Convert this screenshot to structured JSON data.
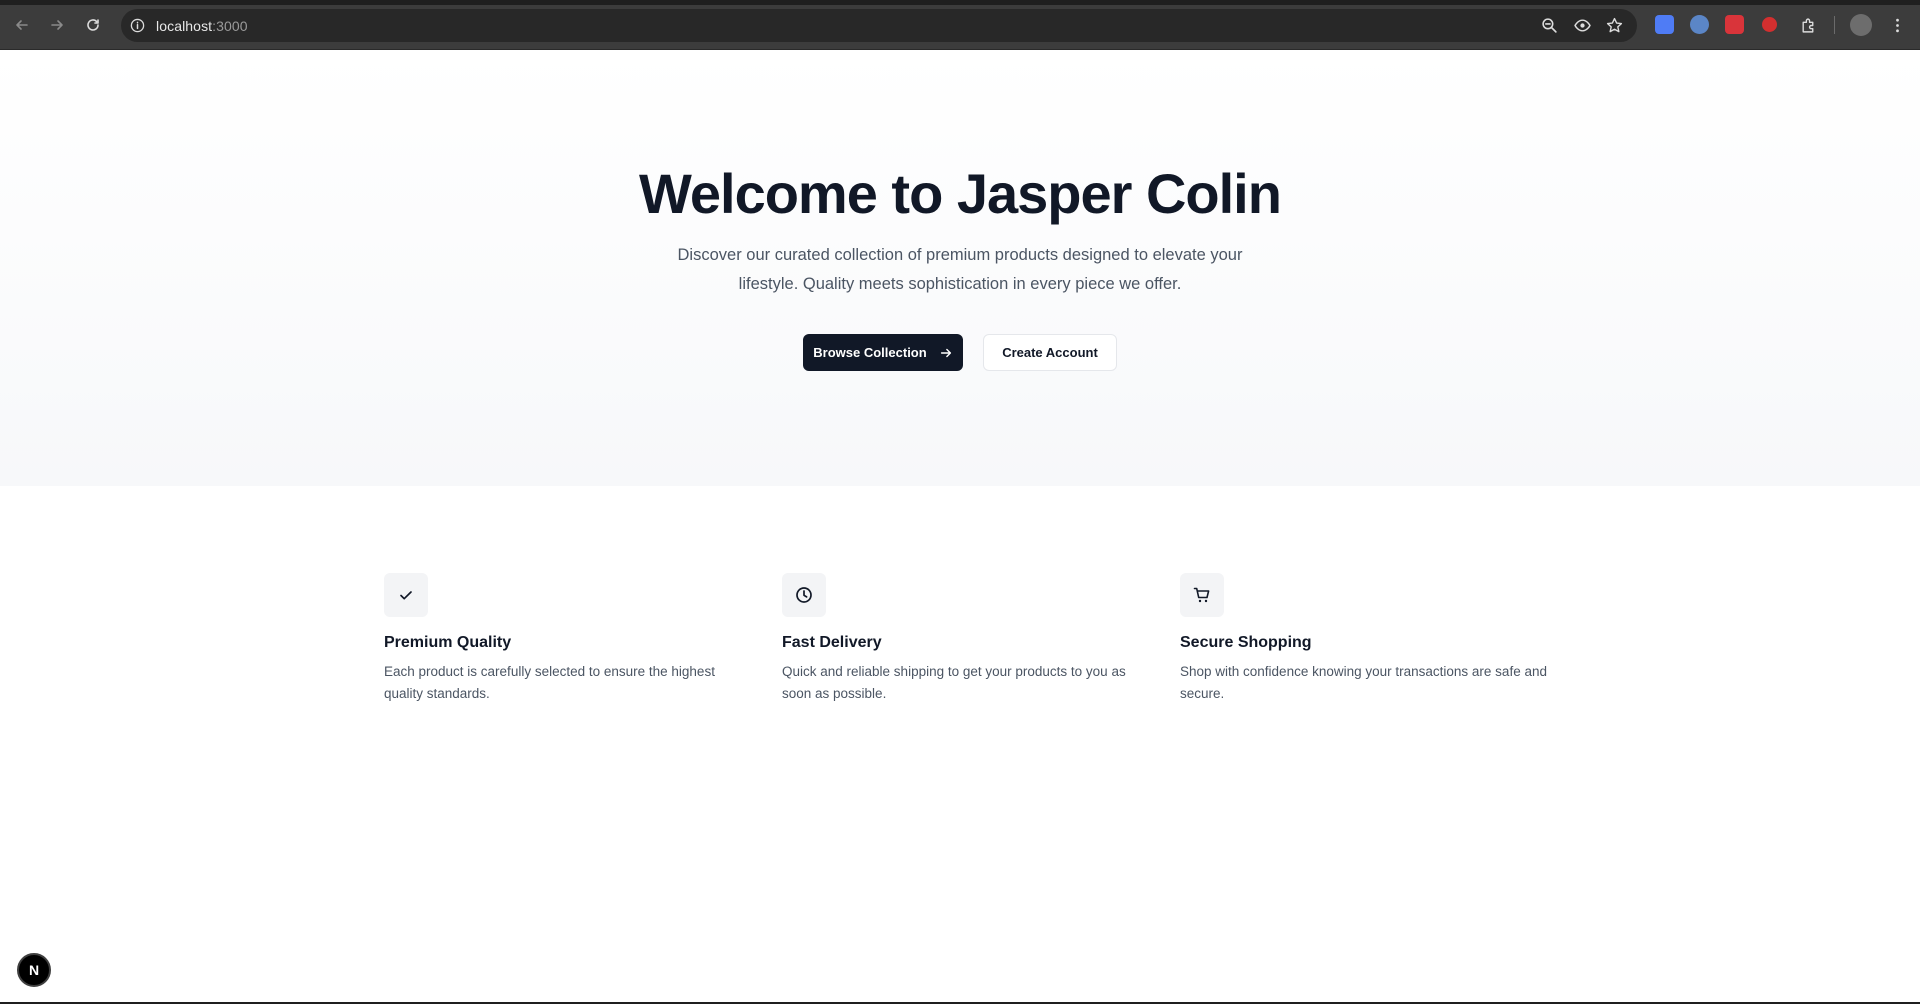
{
  "browser": {
    "url_host": "localhost",
    "url_port": ":3000",
    "extension_colors": [
      "#4f7cf5",
      "#5b86c7",
      "#d9343a",
      "#d32f2f"
    ]
  },
  "hero": {
    "title": "Welcome to Jasper Colin",
    "description": "Discover our curated collection of premium products designed to elevate your lifestyle. Quality meets sophistication in every piece we offer.",
    "primary_button": "Browse Collection",
    "secondary_button": "Create Account"
  },
  "features": [
    {
      "icon": "check-icon",
      "title": "Premium Quality",
      "description": "Each product is carefully selected to ensure the highest quality standards."
    },
    {
      "icon": "clock-icon",
      "title": "Fast Delivery",
      "description": "Quick and reliable shipping to get your products to you as soon as possible."
    },
    {
      "icon": "cart-icon",
      "title": "Secure Shopping",
      "description": "Shop with confidence knowing your transactions are safe and secure."
    }
  ],
  "dev_badge": {
    "label": "N"
  },
  "colors": {
    "primary": "#111827",
    "muted_text": "#4b5563",
    "hero_bg": "#f7f8fa"
  }
}
